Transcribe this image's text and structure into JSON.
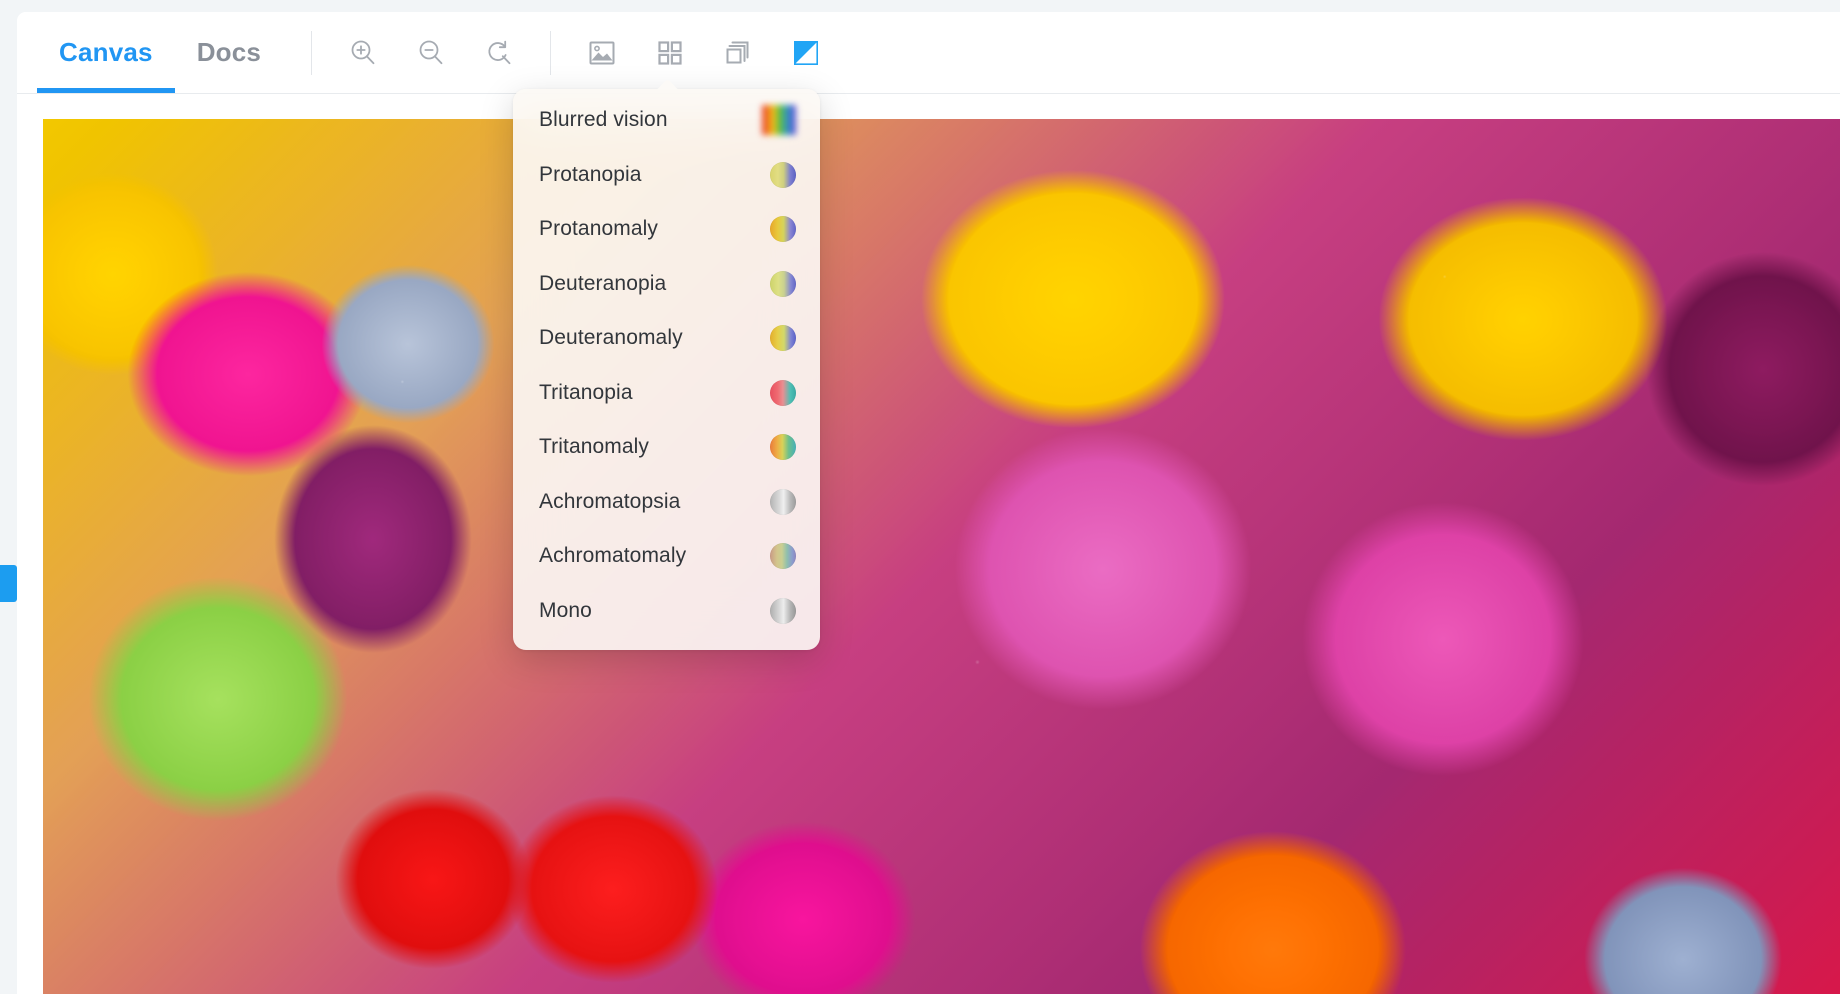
{
  "window": {
    "title": "Canvas"
  },
  "toolbar": {
    "tabs": [
      {
        "label": "Canvas",
        "active": true,
        "name": "tab-canvas"
      },
      {
        "label": "Docs",
        "active": false,
        "name": "tab-docs"
      }
    ],
    "tools": [
      {
        "name": "zoom-in-icon",
        "tooltip": "Zoom in",
        "active": false
      },
      {
        "name": "zoom-out-icon",
        "tooltip": "Zoom out",
        "active": false
      },
      {
        "name": "reset-zoom-icon",
        "tooltip": "Reset zoom",
        "active": false
      },
      {
        "name": "image-icon",
        "tooltip": "Image",
        "active": false
      },
      {
        "name": "grid-icon",
        "tooltip": "Grid",
        "active": false
      },
      {
        "name": "layers-icon",
        "tooltip": "Layers",
        "active": false
      },
      {
        "name": "contrast-icon",
        "tooltip": "Vision simulation",
        "active": true
      }
    ]
  },
  "colors": {
    "accent": "#2196f3",
    "tab_inactive": "#8a9099",
    "menu_text": "#32363b",
    "menu_bg": "#fcfaf6",
    "handle": "#1c9df0"
  },
  "menu": {
    "name": "vision-simulation-menu",
    "items": [
      {
        "label": "Blurred vision",
        "swatch": "rainbow-blurred"
      },
      {
        "label": "Protanopia",
        "swatch": "yellow-blue"
      },
      {
        "label": "Protanomaly",
        "swatch": "orange-blue"
      },
      {
        "label": "Deuteranopia",
        "swatch": "lime-blue"
      },
      {
        "label": "Deuteranomaly",
        "swatch": "gold-blue"
      },
      {
        "label": "Tritanopia",
        "swatch": "red-teal"
      },
      {
        "label": "Tritanomaly",
        "swatch": "orange-teal"
      },
      {
        "label": "Achromatopsia",
        "swatch": "grayscale"
      },
      {
        "label": "Achromatomaly",
        "swatch": "muted-rainbow"
      },
      {
        "label": "Mono",
        "swatch": "grayscale"
      }
    ]
  },
  "canvas": {
    "name": "photo-canvas",
    "image_alt": "Close-up photo of colorful candy-coated chocolate buttons"
  }
}
